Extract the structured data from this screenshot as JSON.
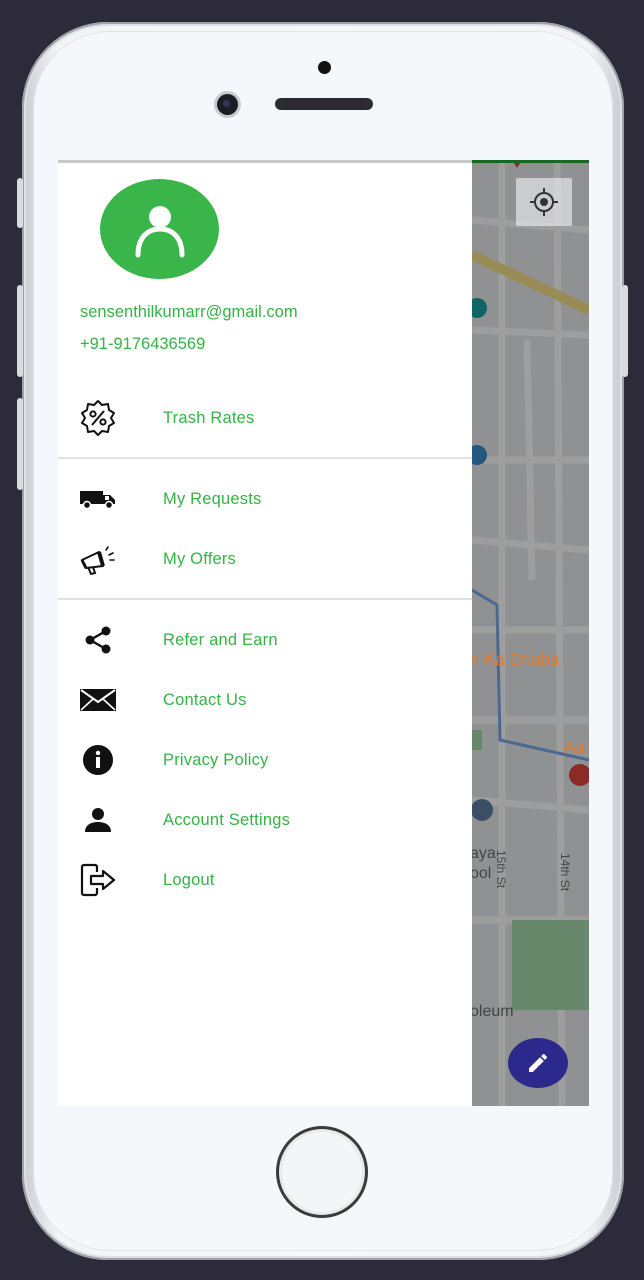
{
  "profile": {
    "email": "sensenthilkumarr@gmail.com",
    "phone": "+91-9176436569"
  },
  "menu": {
    "items": [
      {
        "label": "Trash Rates",
        "icon": "percent-badge-icon"
      },
      {
        "label": "My Requests",
        "icon": "truck-icon"
      },
      {
        "label": "My Offers",
        "icon": "megaphone-icon"
      },
      {
        "label": "Refer and Earn",
        "icon": "share-icon"
      },
      {
        "label": "Contact Us",
        "icon": "envelope-icon"
      },
      {
        "label": "Privacy Policy",
        "icon": "info-icon"
      },
      {
        "label": "Account Settings",
        "icon": "person-icon"
      },
      {
        "label": "Logout",
        "icon": "logout-icon"
      }
    ]
  },
  "map": {
    "labels": [
      "in Ka Dhaba",
      "Aa",
      "aya",
      "ool",
      "15th St",
      "14th St",
      "oleum"
    ]
  },
  "colors": {
    "accent": "#35b345",
    "avatar_bg": "#3ab54a",
    "fab": "#2b2a8c",
    "background": "#2d2a3a"
  }
}
